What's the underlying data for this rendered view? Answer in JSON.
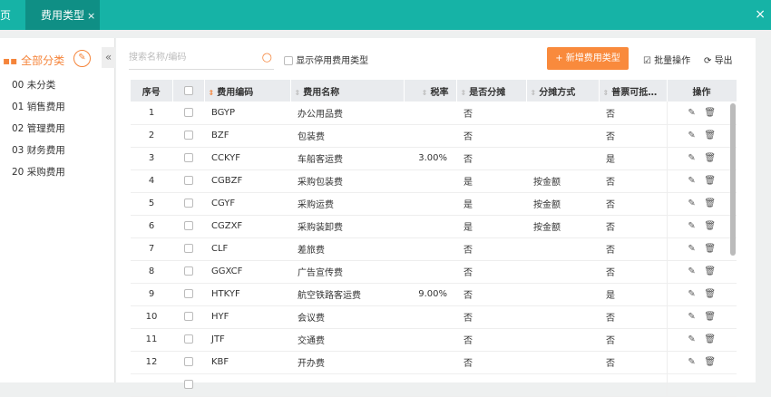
{
  "tabs": {
    "home": "页",
    "active": "费用类型",
    "close": "×",
    "close_all": "×"
  },
  "sidebar": {
    "all": "全部分类",
    "items": [
      "00 未分类",
      "01 销售费用",
      "02 管理费用",
      "03 财务费用",
      "20 采购费用"
    ]
  },
  "toolbar": {
    "search_placeholder": "搜索名称/编码",
    "show_disabled": "显示停用费用类型",
    "add": "+ 新增费用类型",
    "batch": "批量操作",
    "export": "导出"
  },
  "table": {
    "headers": [
      "序号",
      "",
      "费用编码",
      "费用名称",
      "税率",
      "是否分摊",
      "分摊方式",
      "普票可抵…",
      "操作"
    ],
    "rows": [
      [
        "1",
        "BGYP",
        "办公用品费",
        "",
        "否",
        "",
        "否"
      ],
      [
        "2",
        "BZF",
        "包装费",
        "",
        "否",
        "",
        "否"
      ],
      [
        "3",
        "CCKYF",
        "车船客运费",
        "3.00%",
        "否",
        "",
        "是"
      ],
      [
        "4",
        "CGBZF",
        "采购包装费",
        "",
        "是",
        "按金额",
        "否"
      ],
      [
        "5",
        "CGYF",
        "采购运费",
        "",
        "是",
        "按金额",
        "否"
      ],
      [
        "6",
        "CGZXF",
        "采购装卸费",
        "",
        "是",
        "按金额",
        "否"
      ],
      [
        "7",
        "CLF",
        "差旅费",
        "",
        "否",
        "",
        "否"
      ],
      [
        "8",
        "GGXCF",
        "广告宣传费",
        "",
        "否",
        "",
        "否"
      ],
      [
        "9",
        "HTKYF",
        "航空铁路客运费",
        "9.00%",
        "否",
        "",
        "是"
      ],
      [
        "10",
        "HYF",
        "会议费",
        "",
        "否",
        "",
        "否"
      ],
      [
        "11",
        "JTF",
        "交通费",
        "",
        "否",
        "",
        "否"
      ],
      [
        "12",
        "KBF",
        "开办费",
        "",
        "否",
        "",
        "否"
      ]
    ]
  }
}
